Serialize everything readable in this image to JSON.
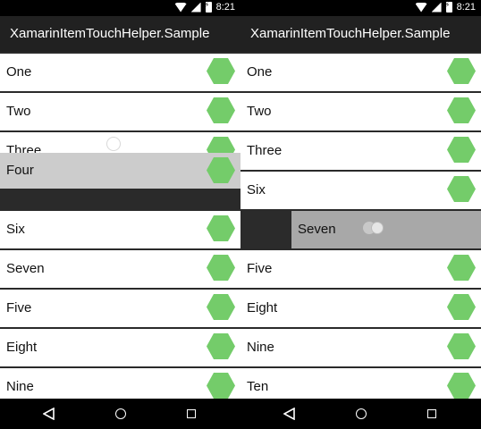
{
  "status": {
    "time": "8:21"
  },
  "app": {
    "title": "XamarinItemTouchHelper.Sample"
  },
  "colors": {
    "hexagon": "#74cc6a",
    "drag_row": "#cccccc",
    "swipe_row": "#a8a8a8"
  },
  "left": {
    "rows": [
      "One",
      "Two",
      "Three",
      "Six",
      "Seven",
      "Five",
      "Eight",
      "Nine"
    ],
    "dragging_item": "Four"
  },
  "right": {
    "rows": [
      "One",
      "Two",
      "Three",
      "Six",
      "Five",
      "Eight",
      "Nine",
      "Ten"
    ],
    "swiping_item": "Seven"
  },
  "nav": {
    "back": "back-icon",
    "home": "home-icon",
    "recents": "recents-icon"
  }
}
